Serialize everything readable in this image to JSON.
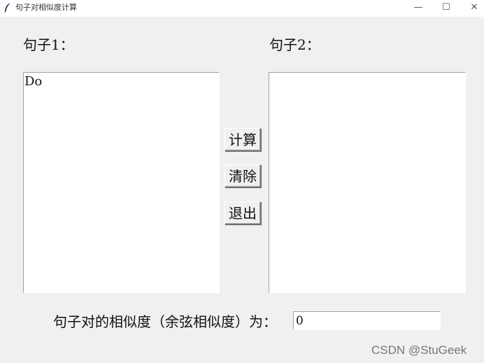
{
  "window": {
    "title": "句子对相似度计算",
    "min_glyph": "—",
    "max_glyph": "☐",
    "close_glyph": "✕"
  },
  "main": {
    "sentence1_label": "句子1：",
    "sentence2_label": "句子2：",
    "sentence1_value": "Do",
    "sentence2_value": "",
    "buttons": {
      "compute": "计算",
      "clear": "清除",
      "exit": "退出"
    },
    "result_label": "句子对的相似度（余弦相似度）为：",
    "result_value": "0"
  },
  "watermark": "CSDN @StuGeek"
}
